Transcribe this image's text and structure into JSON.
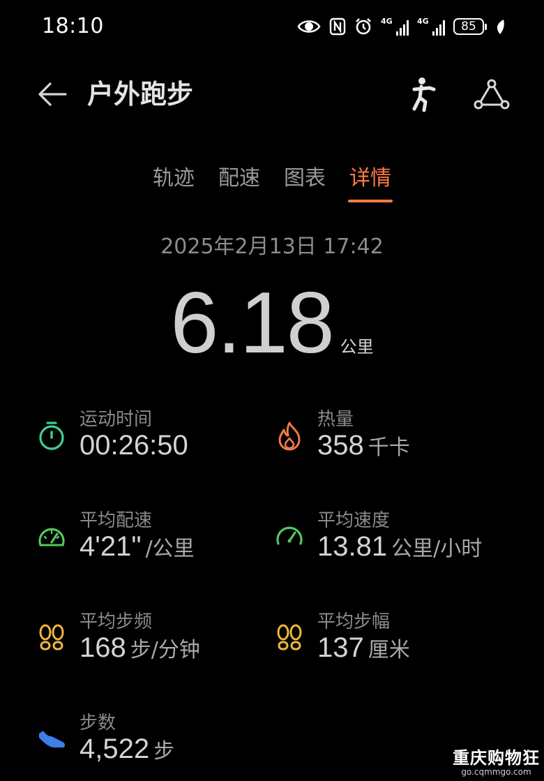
{
  "status_bar": {
    "time": "18:10",
    "network_label": "4G",
    "battery": "85",
    "icons": [
      "eye-icon",
      "nfc-icon",
      "alarm-icon",
      "signal-4g-icon",
      "signal-4g-icon",
      "battery-icon",
      "leaf-icon"
    ]
  },
  "header": {
    "title": "户外跑步",
    "back_icon": "arrow-left-icon",
    "run_icon": "runner-icon",
    "share_icon": "route-icon"
  },
  "tabs": [
    {
      "label": "轨迹",
      "active": false
    },
    {
      "label": "配速",
      "active": false
    },
    {
      "label": "图表",
      "active": false
    },
    {
      "label": "详情",
      "active": true
    }
  ],
  "summary": {
    "datetime": "2025年2月13日 17:42",
    "distance": "6.18",
    "distance_unit": "公里"
  },
  "stats": {
    "duration": {
      "label": "运动时间",
      "value": "00:26:50",
      "unit": "",
      "icon": "stopwatch-icon",
      "color": "#3ecf8e"
    },
    "calories": {
      "label": "热量",
      "value": "358",
      "unit": "千卡",
      "icon": "flame-icon",
      "color": "#f07a4a"
    },
    "avg_pace": {
      "label": "平均配速",
      "value": "4'21\"",
      "unit": "/公里",
      "icon": "speedometer-icon",
      "color": "#54c95c"
    },
    "avg_speed": {
      "label": "平均速度",
      "value": "13.81",
      "unit": "公里/小时",
      "icon": "gauge-icon",
      "color": "#54c95c"
    },
    "avg_cadence": {
      "label": "平均步频",
      "value": "168",
      "unit": "步/分钟",
      "icon": "footprints-icon",
      "color": "#f0b73e"
    },
    "avg_stride": {
      "label": "平均步幅",
      "value": "137",
      "unit": "厘米",
      "icon": "footprints-icon",
      "color": "#f0b73e"
    },
    "steps": {
      "label": "步数",
      "value": "4,522",
      "unit": "步",
      "icon": "shoe-icon",
      "color": "#3f7de8"
    }
  },
  "watermark": {
    "title": "重庆购物狂",
    "subtitle": "go.cqmmgo.com"
  },
  "colors": {
    "accent": "#ff7a45",
    "background": "#000000"
  }
}
